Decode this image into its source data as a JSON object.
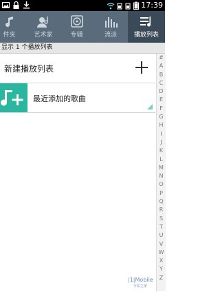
{
  "status_bar": {
    "time": "17:39"
  },
  "tabs": [
    {
      "label": "件夹",
      "icon": "folder-icon",
      "active": false
    },
    {
      "label": "艺术家",
      "icon": "artist-icon",
      "active": false
    },
    {
      "label": "专辑",
      "icon": "album-icon",
      "active": false
    },
    {
      "label": "流派",
      "icon": "genre-icon",
      "active": false
    },
    {
      "label": "播放列表",
      "icon": "playlist-icon",
      "active": true
    }
  ],
  "info_bar": {
    "text": "显示 1 个播放列表"
  },
  "new_playlist": {
    "label": "新建播放列表",
    "icon": "plus-icon"
  },
  "playlists": [
    {
      "label": "最近添加的歌曲",
      "icon": "music-note-plus-icon"
    }
  ],
  "index_letters": [
    "#",
    "A",
    "B",
    "C",
    "D",
    "E",
    "F",
    "G",
    "H",
    "I",
    "J",
    "K",
    "L",
    "M",
    "N",
    "O",
    "P",
    "Q",
    "R",
    "S",
    "T",
    "U",
    "V",
    "W",
    "X",
    "Y",
    "Z"
  ],
  "watermark": {
    "main": "|1|Mobile",
    "sub": "手机之家"
  },
  "colors": {
    "tab_bg": "#5a6b7c",
    "tab_active_bg": "#3b4a58",
    "art_bg": "#2bb6a0"
  }
}
